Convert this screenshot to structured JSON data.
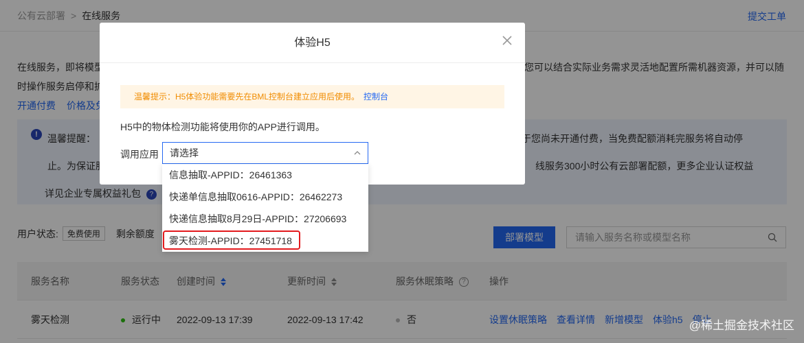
{
  "breadcrumb": {
    "parent": "公有云部署",
    "separator": ">",
    "current": "在线服务"
  },
  "header": {
    "ticket_link": "提交工单"
  },
  "description": {
    "line1_start": "在线服务，即将模型",
    "line1_end": "您可以结合实际业务需求灵活地配置所需机器资源，并可以随",
    "line2_start": "时操作服务启停和扩",
    "links": [
      "开通付费",
      "价格及免"
    ]
  },
  "tip": {
    "line1_start": "温馨提醒：",
    "line1_end": "于您尚未开通付费，当免费配额消耗完服务将自动停",
    "line2_start": "止。为保证服",
    "line2_end": "线服务300小时公有云部署配额，更多企业认证权益",
    "line3_start": "详见企业专属权益礼包"
  },
  "status_row": {
    "label": "用户状态:",
    "badge": "免费使用",
    "quota_label": "剩余额度"
  },
  "deploy_button": "部署模型",
  "search": {
    "placeholder": "请输入服务名称或模型名称"
  },
  "table": {
    "headers": {
      "name": "服务名称",
      "status": "服务状态",
      "created": "创建时间",
      "updated": "更新时间",
      "sleep": "服务休眠策略",
      "ops": "操作"
    },
    "rows": [
      {
        "name": "雾天检测",
        "status": "运行中",
        "created": "2022-09-13 17:39",
        "updated": "2022-09-13 17:42",
        "sleep": "否",
        "ops": [
          "设置休眠策略",
          "查看详情",
          "新增模型",
          "体验h5",
          "停止"
        ]
      }
    ]
  },
  "modal": {
    "title": "体验H5",
    "warning": "温馨提示：H5体验功能需要先在BML控制台建立应用后使用。",
    "warning_link": "控制台",
    "info": "H5中的物体检测功能将使用你的APP进行调用。",
    "field_label": "调用应用",
    "select_placeholder": "请选择"
  },
  "dropdown": {
    "options": [
      "信息抽取-APPID：26461363",
      "快递单信息抽取0616-APPID：26462273",
      "快递信息抽取8月29日-APPID：27206693",
      "雾天检测-APPID：27451718"
    ],
    "highlighted_index": 3
  },
  "watermark": "@稀土掘金技术社区",
  "colors": {
    "accent": "#2468f2",
    "warning": "#f08c00",
    "warning_bg": "#fff5e5",
    "highlight": "#e3191c",
    "running": "#30bf13"
  }
}
